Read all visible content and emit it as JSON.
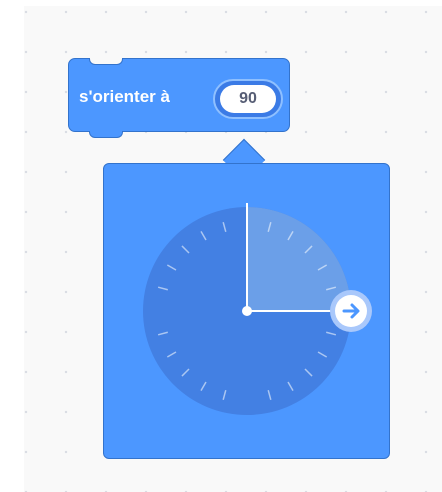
{
  "block": {
    "label": "s'orienter à",
    "value": "90"
  },
  "dial": {
    "direction_degrees": 90,
    "handle_icon": "arrow-right-icon"
  },
  "colors": {
    "block_fill": "#4c97ff",
    "block_border": "#3373cc",
    "dial_face": "#4380e3",
    "dial_sector": "#6b9fe8",
    "handle_arrow": "#4c97ff"
  }
}
